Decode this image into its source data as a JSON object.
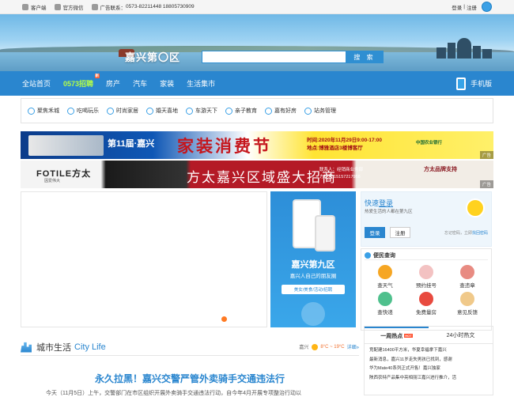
{
  "topbar": {
    "client": "客户端",
    "wechat": "官方微信",
    "ad_contact": "广告联系：",
    "phones": "0573-82211448 18805730909",
    "login": "登录",
    "separator": "|",
    "register": "注册"
  },
  "banner": {
    "logo": "嘉兴第〇区",
    "search_placeholder": "",
    "search_button": "搜 索"
  },
  "nav": {
    "items": [
      "全站首页",
      "0573招聘",
      "房产",
      "汽车",
      "家装",
      "生活集市"
    ],
    "badge": "新",
    "mobile": "手机版"
  },
  "categories": [
    "聚焦禾城",
    "吃喝玩乐",
    "时尚家居",
    "婚天喜地",
    "车游天下",
    "亲子教育",
    "嘉有好房",
    "站务管理"
  ],
  "ad1": {
    "headline": "第11届·嘉兴",
    "title": "家装消费节",
    "time": "时间:2020年11月29日9:00-17:00",
    "place": "地点:博雅酒店3楼博客厅",
    "bank": "中国农业银行",
    "label": "广告"
  },
  "ad2": {
    "brand": "FOTILE方太",
    "brand_sub": "因爱伟大",
    "title": "方太嘉兴区域盛大招商",
    "contact_1": "联系人：经销商业务部",
    "contact_2": "方经理 15157217956",
    "brand_title": "方太品牌支持",
    "label": "广告"
  },
  "promo": {
    "title": "嘉兴第九区",
    "subtitle": "嘉兴人自己的朋友圈",
    "tags": "美女/美食/活动/招聘"
  },
  "login": {
    "quick": "快速",
    "quick_link": "登录",
    "sub": "热爱生活的人都在第九区",
    "login_btn": "登录",
    "register_btn": "注册",
    "forgot": "忘记密码，立即",
    "retrieve": "找回密码"
  },
  "query": {
    "title": "便民查询",
    "items": [
      "查天气",
      "预约挂号",
      "查违章",
      "查快递",
      "免费量房",
      "意见反馈"
    ]
  },
  "citylife": {
    "cn": "城市生活",
    "en": "City Life",
    "city": "嘉兴",
    "temp": "8°C ~ 19°C",
    "more": "详细»"
  },
  "headline": "永久拉黑！嘉兴交警严管外卖骑手交通违法行",
  "body_line": "今天（11月5日）上午，交警部门在市区组织开展外卖骑手交通违法行动，自今年4月开展专项整治行动以",
  "hot": {
    "tab1": "一周热点",
    "tab1_badge": "HOT",
    "tab2": "24小时热文",
    "items": [
      "竞配建16400平方米，华夏幸福拿下嘉兴",
      "最新消息，嘉兴11岁走失男孩已找到，感谢",
      "华为Mate40系列正式开售！嘉兴独家",
      "陕西农特产品集中亮相丽江嘉兴进行推介，活"
    ]
  },
  "colors": {
    "brand_blue": "#2a86cf",
    "nav_highlight": "#b6ff46",
    "accent_orange": "#ff7a23"
  }
}
